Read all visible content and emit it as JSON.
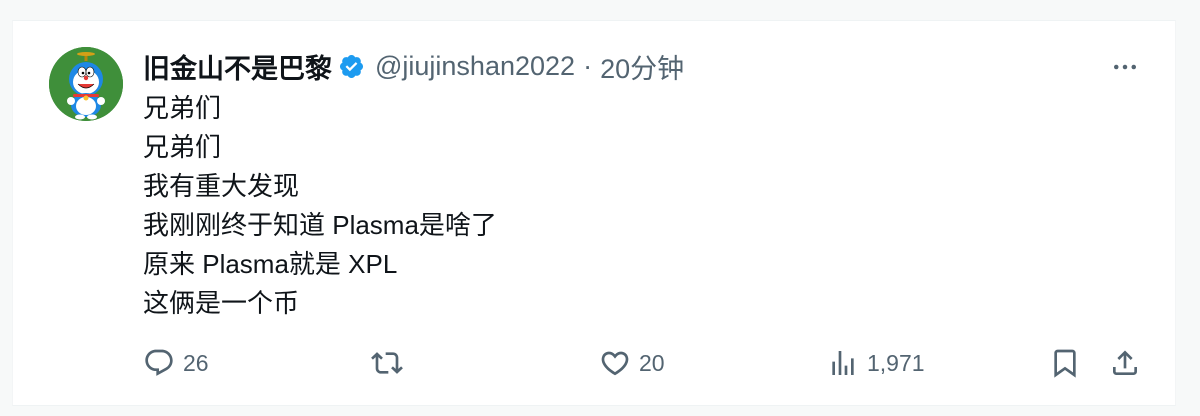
{
  "tweet": {
    "author": {
      "display_name": "旧金山不是巴黎",
      "handle": "@jiujinshan2022",
      "separator": "·",
      "time": "20分钟",
      "verified": true,
      "avatar_icon": "doraemon-avatar"
    },
    "body_lines": [
      "兄弟们",
      "兄弟们",
      "我有重大发现",
      "我刚刚终于知道 Plasma是啥了",
      "原来 Plasma就是 XPL",
      "这俩是一个币"
    ],
    "actions": {
      "reply": {
        "icon": "reply-icon",
        "count": "26"
      },
      "retweet": {
        "icon": "retweet-icon",
        "count": ""
      },
      "like": {
        "icon": "heart-icon",
        "count": "20"
      },
      "views": {
        "icon": "views-icon",
        "count": "1,971"
      },
      "bookmark": {
        "icon": "bookmark-icon"
      },
      "share": {
        "icon": "share-icon"
      }
    },
    "colors": {
      "text_primary": "#0f1419",
      "text_secondary": "#536471",
      "verified_blue": "#1d9bf0",
      "avatar_bg": "#3f8f3a"
    }
  }
}
